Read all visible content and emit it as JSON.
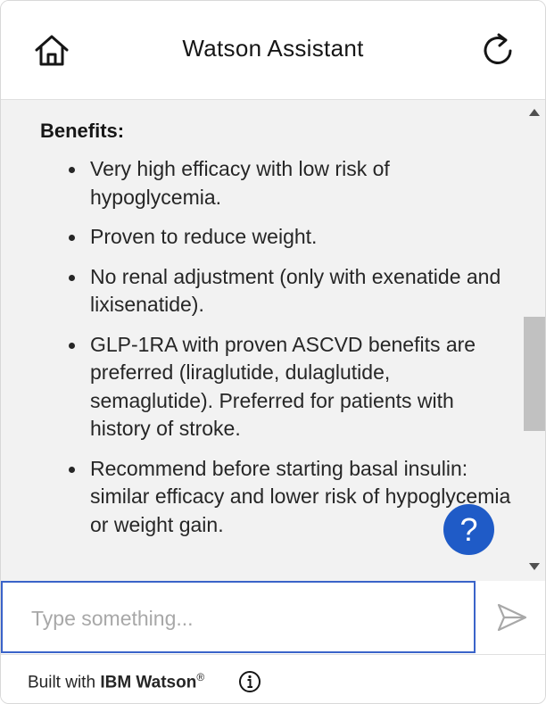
{
  "header": {
    "title": "Watson Assistant",
    "home_icon": "home-icon",
    "restart_icon": "restart-icon"
  },
  "message": {
    "heading": "Benefits:",
    "items": [
      "Very high efficacy with low risk of hypoglycemia.",
      "Proven to reduce weight.",
      "No renal adjustment (only with exenatide and lixisenatide).",
      "GLP-1RA with proven ASCVD benefits are preferred (liraglutide, dulaglutide, semaglutide). Preferred for patients with history of stroke.",
      "Recommend before starting basal insulin: similar efficacy and lower risk of hypoglycemia or weight gain."
    ]
  },
  "help_button": {
    "label": "?"
  },
  "input": {
    "placeholder": "Type something...",
    "value": ""
  },
  "footer": {
    "built_with": "Built with",
    "brand": "IBM Watson",
    "trademark": "®"
  },
  "colors": {
    "accent": "#1f5bc7",
    "input_border": "#3a63c9",
    "chat_background": "#f2f2f2"
  }
}
